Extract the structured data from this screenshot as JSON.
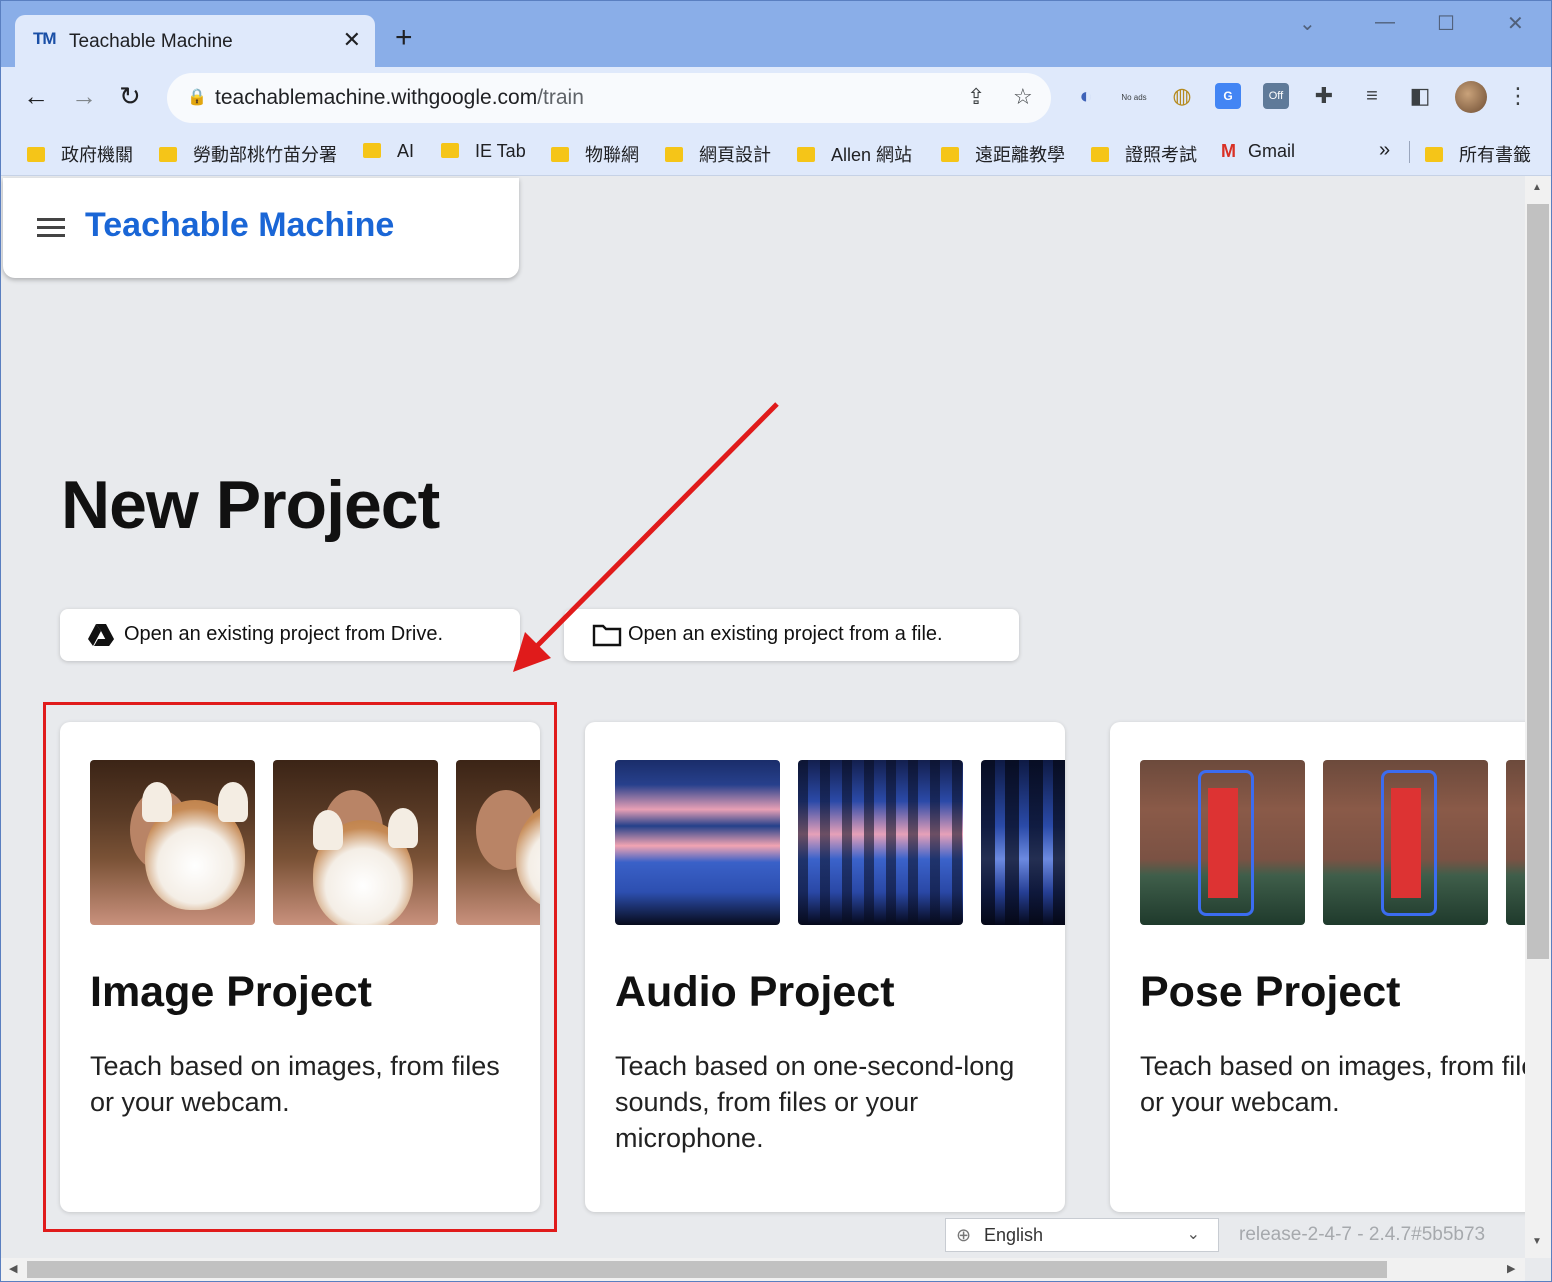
{
  "browser": {
    "tab_logo": "TM",
    "tab_title": "Teachable Machine",
    "tab_close": "✕",
    "new_tab": "+",
    "url_host": "teachablemachine.withgoogle.com",
    "url_path": "/train",
    "extensions": [
      "extension-swirl-icon",
      "no-ads-icon",
      "extension-cookie-icon",
      "google-translate-icon",
      "off-toggle-icon",
      "puzzle-icon",
      "media-icon",
      "side-panel-icon"
    ],
    "ext_noads_label": "No ads",
    "ext_off_label": "Off"
  },
  "bookmarks": [
    {
      "label": "政府機關",
      "type": "folder"
    },
    {
      "label": "勞動部桃竹苗分署",
      "type": "folder"
    },
    {
      "label": "AI",
      "type": "folder"
    },
    {
      "label": "IE Tab",
      "type": "folder"
    },
    {
      "label": "物聯網",
      "type": "folder"
    },
    {
      "label": "網頁設計",
      "type": "folder"
    },
    {
      "label": "Allen 網站",
      "type": "folder"
    },
    {
      "label": "遠距離教學",
      "type": "folder"
    },
    {
      "label": "證照考試",
      "type": "folder"
    },
    {
      "label": "Gmail",
      "type": "gmail"
    },
    {
      "label": "所有書籤",
      "type": "folder"
    }
  ],
  "bookmarks_more": "»",
  "app": {
    "brand": "Teachable Machine",
    "heading": "New Project",
    "open_drive": "Open an existing project from Drive.",
    "open_file": "Open an existing project from a file."
  },
  "projects": [
    {
      "title": "Image Project",
      "desc": "Teach based on images, from files or your webcam."
    },
    {
      "title": "Audio Project",
      "desc": "Teach based on one-second-long sounds, from files or your microphone."
    },
    {
      "title": "Pose Project",
      "desc": "Teach based on images, from files or your webcam."
    }
  ],
  "footer": {
    "language": "English",
    "release": "release-2-4-7 - 2.4.7#5b5b73"
  },
  "colors": {
    "brand": "#1a66d6",
    "annotation": "#e01b1b",
    "titlebar": "#8aaee8"
  }
}
